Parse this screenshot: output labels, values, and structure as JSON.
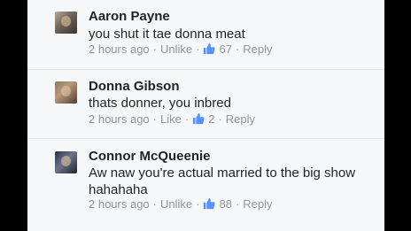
{
  "colors": {
    "name": "#1d2129",
    "meta": "#90949c",
    "like_icon": "#5890ff",
    "panel_bg": "#f6f7f9"
  },
  "comments": [
    {
      "author": "Aaron Payne",
      "text": "you shut it tae donna meat",
      "time": "2 hours ago",
      "like_action": "Unlike",
      "like_icon": "thumbs-up-icon",
      "like_count": "67",
      "reply": "Reply"
    },
    {
      "author": "Donna Gibson",
      "text": "thats donner, you inbred",
      "time": "2 hours ago",
      "like_action": "Like",
      "like_icon": "thumbs-up-icon",
      "like_count": "2",
      "reply": "Reply"
    },
    {
      "author": "Connor McQueenie",
      "text_lines": [
        "Aw naw you're actual married to the big show",
        "hahahaha"
      ],
      "time": "2 hours ago",
      "like_action": "Unlike",
      "like_icon": "thumbs-up-icon",
      "like_count": "88",
      "reply": "Reply"
    }
  ]
}
